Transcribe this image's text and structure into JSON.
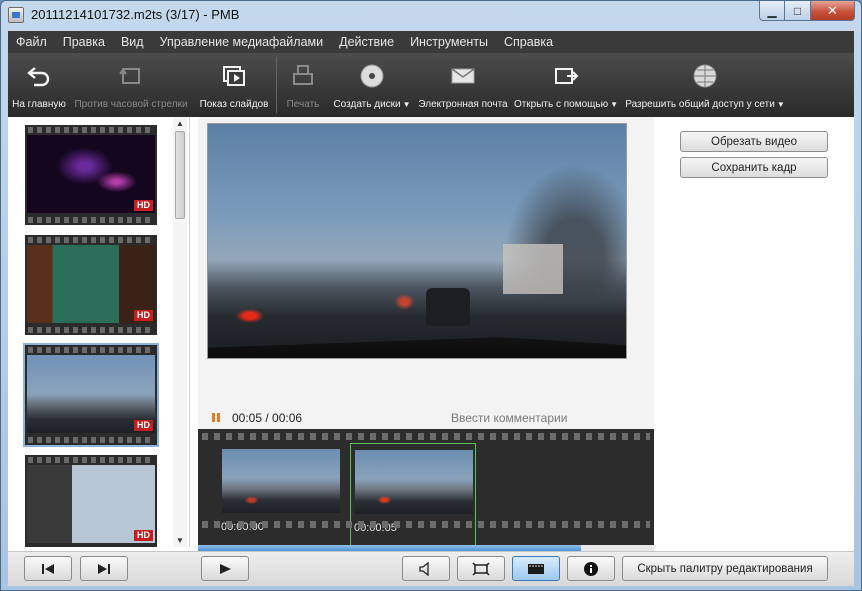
{
  "window": {
    "title": "20111214101732.m2ts (3/17)  - PMB"
  },
  "menu": [
    "Файл",
    "Правка",
    "Вид",
    "Управление медиафайлами",
    "Действие",
    "Инструменты",
    "Справка"
  ],
  "toolbar": {
    "home": "На главную",
    "rotate_ccw": "Против часовой стрелки",
    "slideshow": "Показ слайдов",
    "print": "Печать",
    "create_disc": "Создать диски",
    "email": "Электронная почта",
    "open_with": "Открыть с помощью",
    "share": "Разрешить общий доступ у сети"
  },
  "thumbnails": {
    "badge": "HD"
  },
  "editing": {
    "trim_video": "Обрезать видео",
    "save_frame": "Сохранить кадр"
  },
  "playback": {
    "timecode": "00:05 / 00:06",
    "comment_placeholder": "Ввести комментарии",
    "progress": 0.84
  },
  "timeline": {
    "frames": [
      "00:00:00",
      "00:00:05"
    ]
  },
  "bottom": {
    "hide_palette": "Скрыть палитру редактирования"
  }
}
